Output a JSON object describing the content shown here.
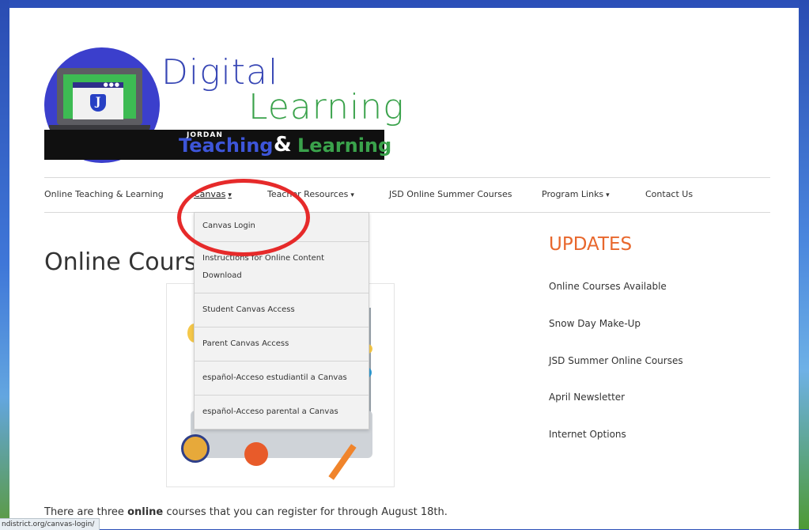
{
  "site": {
    "logo": {
      "word1": "Digital",
      "word2": "Learning",
      "banner_small": "JORDAN",
      "banner_word1": "eaching",
      "banner_amp": "&",
      "banner_word2": "earning"
    }
  },
  "nav": {
    "items": [
      {
        "label": "Online Teaching & Learning",
        "has_dropdown": false
      },
      {
        "label": "Canvas",
        "has_dropdown": true,
        "active": true
      },
      {
        "label": "Teacher Resources",
        "has_dropdown": true
      },
      {
        "label": "JSD Online Summer Courses",
        "has_dropdown": false
      },
      {
        "label": "Program Links",
        "has_dropdown": true
      },
      {
        "label": "Contact Us",
        "has_dropdown": false
      }
    ],
    "chevron": "⌄"
  },
  "dropdown": {
    "items": [
      "Canvas Login",
      "Instructions for Online Content Download",
      "Student Canvas Access",
      "Parent Canvas Access",
      "español-Acceso estudiantil a Canvas",
      "español-Acceso parental a Canvas"
    ]
  },
  "main": {
    "title": "Online Courses",
    "intro_before": "There are three ",
    "intro_bold": "online",
    "intro_after": " courses that you can register for through August 18th."
  },
  "sidebar": {
    "title": "UPDATES",
    "links": [
      "Online Courses Available",
      "Snow Day Make-Up",
      "JSD Summer Online Courses",
      "April Newsletter",
      "Internet Options"
    ]
  },
  "status_bar": {
    "url": "ndistrict.org/canvas-login/"
  },
  "colors": {
    "accent_orange": "#e8672c",
    "logo_blue": "#3847b5",
    "logo_green": "#3aa24b",
    "annotation_red": "#e62a2a"
  }
}
